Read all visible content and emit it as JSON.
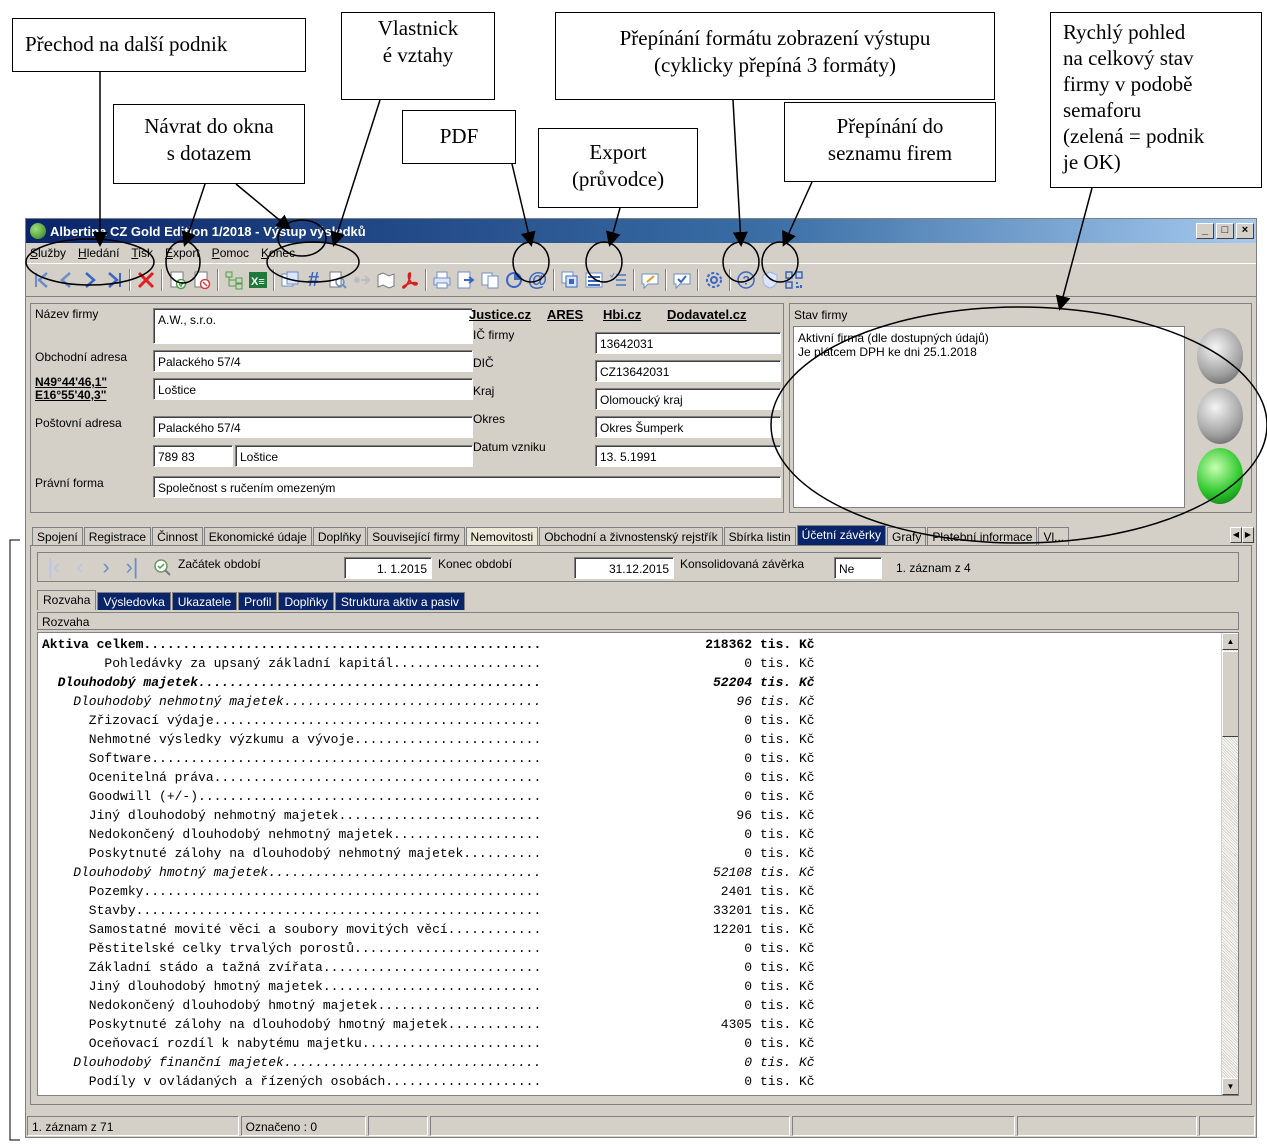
{
  "annotations": {
    "next_company": "Přechod na další podnik",
    "ownership": "Vlastnick\né vztahy",
    "format_toggle": "Přepínání formátu zobrazení výstupu\n(cyklicky přepíná 3 formáty)",
    "traffic_light": "Rychlý pohled\nna celkový stav\nfirmy v podobě\nsemaforu\n(zelená = podnik\nje OK)",
    "back_to_query": "Návrat do okna\ns dotazem",
    "pdf": "PDF",
    "export": "Export\n(průvodce)",
    "company_list": "Přepínání do\nseznamu firem"
  },
  "window": {
    "title": "Albertina CZ Gold Edition 1/2018 - Výstup výsledků",
    "controls": [
      "_",
      "□",
      "×"
    ]
  },
  "menu": [
    "Služby",
    "Hledání",
    "Tisk",
    "Export",
    "Pomoc",
    "Konec"
  ],
  "company": {
    "labels": {
      "name": "Název firmy",
      "business_address": "Obchodní adresa",
      "gps_lat": "N49°44'46,1\"",
      "gps_lon": "E16°55'40,3\"",
      "postal_address": "Poštovní adresa",
      "legal_form": "Právní forma",
      "ico": "IČ firmy",
      "dic": "DIČ",
      "region": "Kraj",
      "district": "Okres",
      "founded": "Datum vzniku"
    },
    "links": [
      "Justice.cz",
      "ARES",
      "Hbi.cz",
      "Dodavatel.cz"
    ],
    "values": {
      "name": "A.W., s.r.o.",
      "street": "Palackého 57/4",
      "city": "Loštice",
      "postal_street": "Palackého 57/4",
      "postal_zip": "789 83",
      "postal_city": "Loštice",
      "legal_form": "Společnost s ručením omezeným",
      "ico": "13642031",
      "dic": "CZ13642031",
      "region": "Olomoucký kraj",
      "district": "Okres Šumperk",
      "founded": "13. 5.1991"
    }
  },
  "status": {
    "title": "Stav firmy",
    "text": "Aktivní firma (dle dostupných údajů)\nJe plátcem DPH ke dni 25.1.2018",
    "light": "green"
  },
  "tabs": [
    "Spojení",
    "Registrace",
    "Činnost",
    "Ekonomické údaje",
    "Doplňky",
    "Související firmy",
    "Nemovitosti",
    "Obchodní a živnostenský rejstřík",
    "Sbírka listin",
    "Účetní závěrky",
    "Grafy",
    "Platební informace",
    "Vl..."
  ],
  "active_tab": "Účetní závěrky",
  "period": {
    "start_label": "Začátek období",
    "start_value": "1. 1.2015",
    "end_label": "Konec období",
    "end_value": "31.12.2015",
    "consolidated_label": "Konsolidovaná závěrka",
    "consolidated_value": "Ne",
    "record_info": "1. záznam z 4"
  },
  "subtabs": [
    "Rozvaha",
    "Výsledovka",
    "Ukazatele",
    "Profil",
    "Doplňky",
    "Struktura aktiv a pasiv"
  ],
  "grid_title": "Rozvaha",
  "rows": [
    {
      "name": "Aktiva celkem",
      "value": "218362",
      "unit": "tis. Kč",
      "style": "bold",
      "indent": 0
    },
    {
      "name": "Pohledávky za upsaný základní kapitál",
      "value": "0",
      "unit": "tis. Kč",
      "style": "",
      "indent": 4
    },
    {
      "name": "Dlouhodobý majetek",
      "value": "52204",
      "unit": "tis. Kč",
      "style": "bolditalic",
      "indent": 1
    },
    {
      "name": "Dlouhodobý nehmotný majetek",
      "value": "96",
      "unit": "tis. Kč",
      "style": "italic",
      "indent": 2
    },
    {
      "name": "Zřizovací výdaje",
      "value": "0",
      "unit": "tis. Kč",
      "style": "",
      "indent": 3
    },
    {
      "name": "Nehmotné výsledky výzkumu a vývoje",
      "value": "0",
      "unit": "tis. Kč",
      "style": "",
      "indent": 3
    },
    {
      "name": "Software",
      "value": "0",
      "unit": "tis. Kč",
      "style": "",
      "indent": 3
    },
    {
      "name": "Ocenitelná práva",
      "value": "0",
      "unit": "tis. Kč",
      "style": "",
      "indent": 3
    },
    {
      "name": "Goodwill (+/-)",
      "value": "0",
      "unit": "tis. Kč",
      "style": "",
      "indent": 3
    },
    {
      "name": "Jiný dlouhodobý nehmotný majetek",
      "value": "96",
      "unit": "tis. Kč",
      "style": "",
      "indent": 3
    },
    {
      "name": "Nedokončený dlouhodobý nehmotný majetek",
      "value": "0",
      "unit": "tis. Kč",
      "style": "",
      "indent": 3
    },
    {
      "name": "Poskytnuté zálohy na dlouhodobý nehmotný majetek",
      "value": "0",
      "unit": "tis. Kč",
      "style": "",
      "indent": 3
    },
    {
      "name": "Dlouhodobý hmotný majetek",
      "value": "52108",
      "unit": "tis. Kč",
      "style": "italic",
      "indent": 2
    },
    {
      "name": "Pozemky",
      "value": "2401",
      "unit": "tis. Kč",
      "style": "",
      "indent": 3
    },
    {
      "name": "Stavby",
      "value": "33201",
      "unit": "tis. Kč",
      "style": "",
      "indent": 3
    },
    {
      "name": "Samostatné movité věci a soubory movitých věcí",
      "value": "12201",
      "unit": "tis. Kč",
      "style": "",
      "indent": 3
    },
    {
      "name": "Pěstitelské celky trvalých porostů",
      "value": "0",
      "unit": "tis. Kč",
      "style": "",
      "indent": 3
    },
    {
      "name": "Základní stádo a tažná zvířata",
      "value": "0",
      "unit": "tis. Kč",
      "style": "",
      "indent": 3
    },
    {
      "name": "Jiný dlouhodobý hmotný majetek",
      "value": "0",
      "unit": "tis. Kč",
      "style": "",
      "indent": 3
    },
    {
      "name": "Nedokončený dlouhodobý hmotný majetek",
      "value": "0",
      "unit": "tis. Kč",
      "style": "",
      "indent": 3
    },
    {
      "name": "Poskytnuté zálohy na dlouhodobý hmotný majetek",
      "value": "4305",
      "unit": "tis. Kč",
      "style": "",
      "indent": 3
    },
    {
      "name": "Oceňovací rozdíl k nabytému majetku",
      "value": "0",
      "unit": "tis. Kč",
      "style": "",
      "indent": 3
    },
    {
      "name": "Dlouhodobý finanční majetek",
      "value": "0",
      "unit": "tis. Kč",
      "style": "italic",
      "indent": 2
    },
    {
      "name": "Podíly v ovládaných a řízených osobách",
      "value": "0",
      "unit": "tis. Kč",
      "style": "",
      "indent": 3
    }
  ],
  "statusbar": {
    "record": "1. záznam z 71",
    "marked": "Označeno : 0"
  },
  "colors": {
    "title_active": "#0a246a",
    "toolbar_blue": "#6d8dc7",
    "close_red": "#e02020",
    "pdf_red": "#d42020",
    "light_green": "#2ec82e"
  }
}
